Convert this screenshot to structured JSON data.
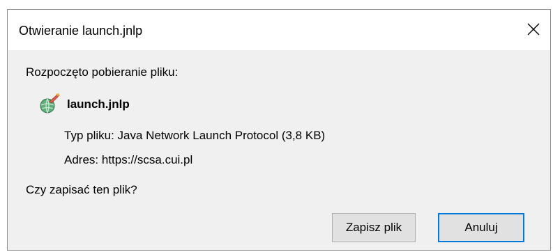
{
  "window": {
    "title": "Otwieranie launch.jnlp"
  },
  "download": {
    "heading": "Rozpoczęto pobieranie pliku:",
    "file_icon": "java-web-start-icon",
    "filename": "launch.jnlp",
    "type_label": "Typ pliku:",
    "type_value": "Java Network Launch Protocol (3,8 KB)",
    "address_label": "Adres:",
    "address_value": "https://scsa.cui.pl",
    "question": "Czy zapisać ten plik?"
  },
  "buttons": {
    "save_label": "Zapisz plik",
    "cancel_label": "Anuluj"
  },
  "colors": {
    "focus_border": "#0078d7",
    "dialog_background": "#f0f0f0"
  }
}
